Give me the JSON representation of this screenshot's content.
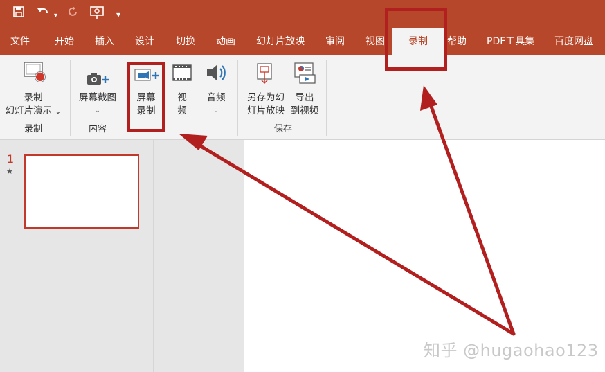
{
  "quick_access": {
    "icons": [
      "save-icon",
      "undo-icon",
      "redo-icon",
      "present-from-start-icon",
      "customize-menu-icon"
    ],
    "customize_glyph": "▾"
  },
  "tabs": [
    "文件",
    "开始",
    "插入",
    "设计",
    "切换",
    "动画",
    "幻灯片放映",
    "审阅",
    "视图",
    "录制",
    "帮助",
    "PDF工具集",
    "百度网盘"
  ],
  "active_tab": "录制",
  "ribbon": {
    "groups": [
      {
        "label": "录制",
        "buttons": [
          {
            "line1": "录制",
            "line2": "幻灯片演示",
            "chevron": "⌄",
            "icon": "record-slideshow-icon"
          }
        ]
      },
      {
        "label": "内容",
        "buttons": [
          {
            "line1": "屏幕截图",
            "chevron": "⌄",
            "icon": "screenshot-icon"
          },
          {
            "line1": "屏幕",
            "line2": "录制",
            "icon": "screen-recording-icon"
          },
          {
            "line1": "视",
            "line2": "频",
            "chevron": "⌄",
            "icon": "video-icon"
          },
          {
            "line1": "音频",
            "chevron": "⌄",
            "icon": "audio-icon"
          }
        ]
      },
      {
        "label": "保存",
        "buttons": [
          {
            "line1": "另存为幻",
            "line2": "灯片放映",
            "icon": "save-as-show-icon"
          },
          {
            "line1": "导出",
            "line2": "到视频",
            "icon": "export-video-icon"
          }
        ]
      }
    ]
  },
  "slides_pane": {
    "slide_number": "1",
    "animation_marker": "★"
  },
  "watermark": "知乎 @hugaohao123",
  "colors": {
    "accent": "#b7472a",
    "annotation": "#b21f1f",
    "ribbon_bg": "#f3f3f3",
    "pane_bg": "#e6e6e6"
  }
}
